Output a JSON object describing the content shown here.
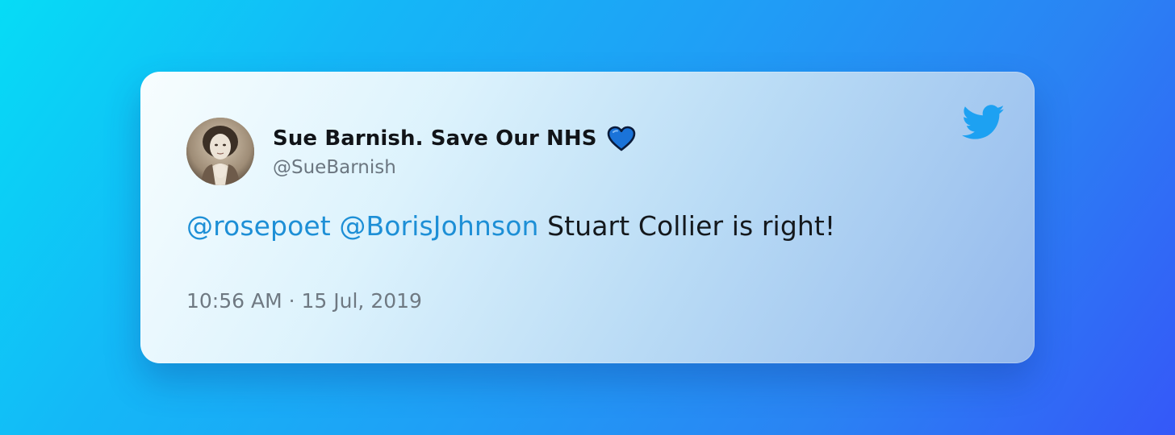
{
  "tweet": {
    "display_name": "Sue Barnish. Save Our NHS",
    "name_emoji_icon": "blue-heart-icon",
    "handle": "@SueBarnish",
    "mention_1": "@rosepoet",
    "mention_2": "@BorisJohnson",
    "text": "Stuart Collier is right!",
    "timestamp": "10:56 AM · 15 Jul, 2019"
  },
  "icons": {
    "brand": "twitter-bird-icon"
  },
  "colors": {
    "mention": "#1d8fd6",
    "twitter_blue": "#1da1f2",
    "heart": "#1a73d9"
  }
}
